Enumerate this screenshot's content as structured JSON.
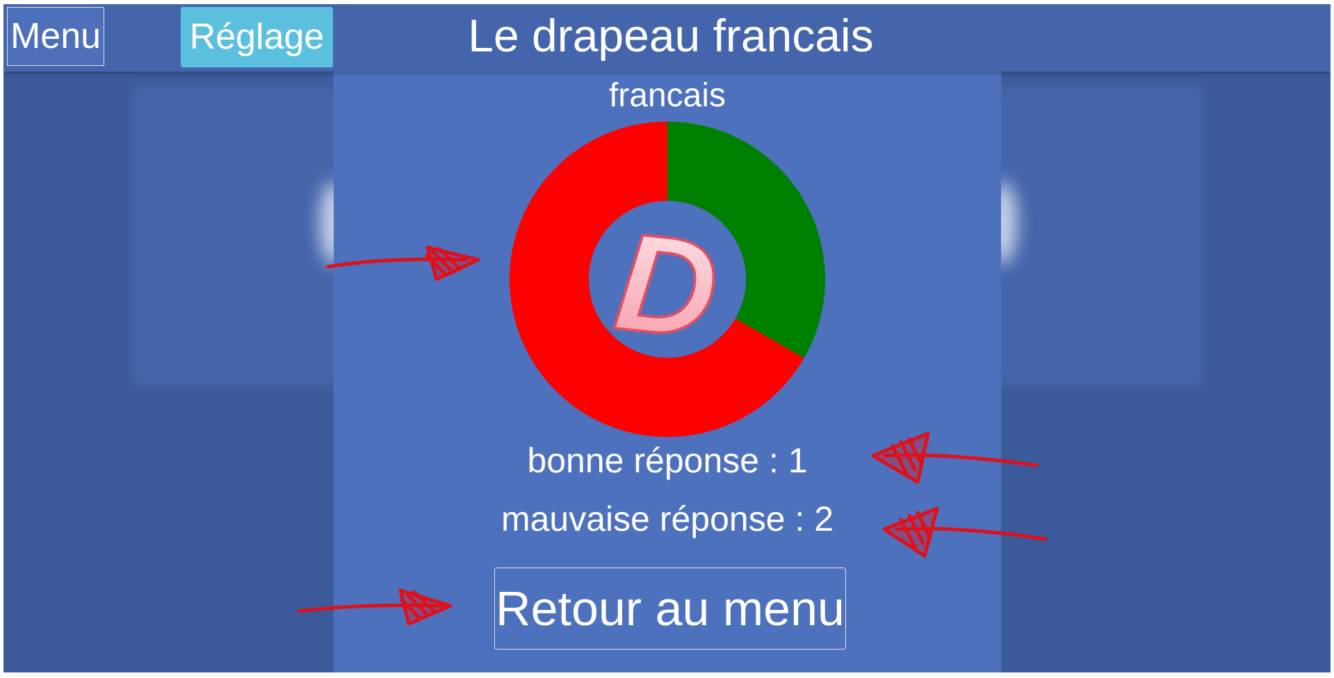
{
  "header": {
    "menu_label": "Menu",
    "settings_label": "Réglage",
    "title": "Le drapeau francais"
  },
  "main": {
    "subject": "francais",
    "center_letter": "D",
    "good_answers_text": "bonne réponse : 1",
    "bad_answers_text": "mauvaise réponse : 2",
    "back_button_label": "Retour au menu"
  },
  "chart_data": {
    "type": "pie",
    "categories": [
      "bonne réponse",
      "mauvaise réponse"
    ],
    "values": [
      1,
      2
    ],
    "colors": [
      "#008000",
      "#ff0000"
    ],
    "donut": true
  },
  "colors": {
    "header_bg": "#4464ab",
    "panel_bg": "#4d71bc",
    "settings_button": "#5bc0de",
    "good": "#008000",
    "bad": "#ff0000",
    "annotation_arrows": "#e0101a"
  }
}
